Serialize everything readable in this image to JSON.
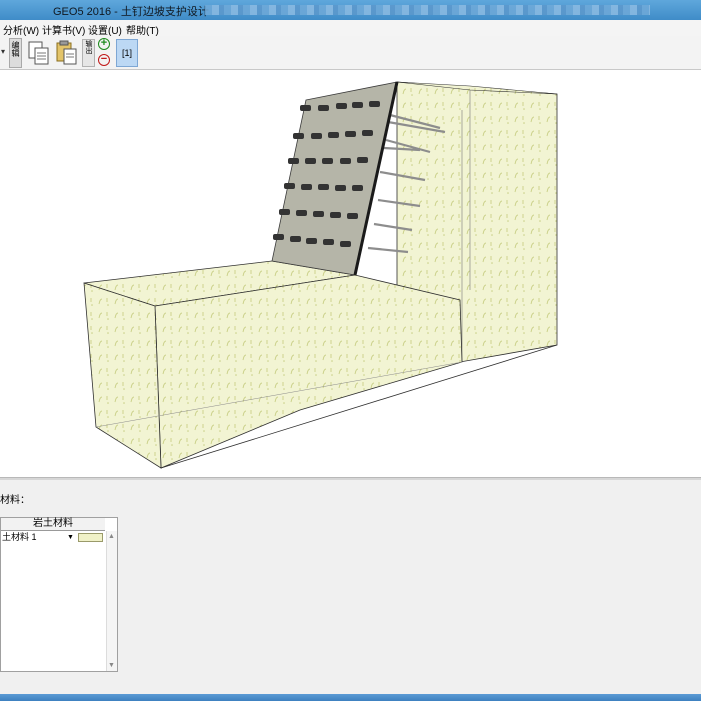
{
  "window": {
    "title": "GEO5 2016 - 土钉边坡支护设计"
  },
  "menu": {
    "items": [
      "分析(W)",
      "计算书(V)",
      "设置(U)",
      "帮助(T)"
    ]
  },
  "toolbar": {
    "vertical_label": "编辑",
    "small_label": "输出",
    "add_symbol": "+",
    "remove_symbol": "−",
    "view_label": "[1]",
    "icons": [
      "copy-icon",
      "copy-to-clipboard-icon",
      "add-icon",
      "remove-icon"
    ]
  },
  "bottom": {
    "section_label": "材料：",
    "grid": {
      "header": "岩土材料",
      "rows": [
        {
          "material": "土材料 1"
        }
      ]
    }
  },
  "colors": {
    "soil": "#f2f4d3",
    "soil_pattern": "#c9cf86",
    "wall": "#b5b5a8",
    "nail_head": "#333333",
    "title_bar": "#4a96d0",
    "status_bar": "#4a8cc9"
  }
}
